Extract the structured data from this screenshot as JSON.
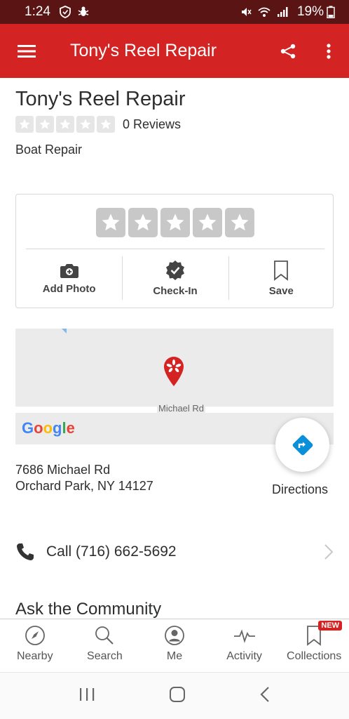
{
  "status_bar": {
    "time": "1:24",
    "battery": "19%"
  },
  "app_bar": {
    "title": "Tony's Reel Repair"
  },
  "business": {
    "name": "Tony's Reel Repair",
    "reviews": "0 Reviews",
    "rating": 0,
    "category": "Boat Repair"
  },
  "actions": [
    {
      "label": "Add Photo",
      "icon": "camera-icon"
    },
    {
      "label": "Check-In",
      "icon": "check-badge-icon"
    },
    {
      "label": "Save",
      "icon": "bookmark-icon"
    }
  ],
  "map": {
    "road_label": "Michael Rd",
    "provider": "Google"
  },
  "address": {
    "line1": "7686 Michael Rd",
    "line2": "Orchard Park, NY 14127"
  },
  "directions": {
    "label": "Directions"
  },
  "call": {
    "label": "Call (716) 662-5692"
  },
  "ask_community": {
    "title": "Ask the Community"
  },
  "bottom_nav": [
    {
      "label": "Nearby",
      "icon": "compass-icon"
    },
    {
      "label": "Search",
      "icon": "search-icon"
    },
    {
      "label": "Me",
      "icon": "profile-icon"
    },
    {
      "label": "Activity",
      "icon": "activity-icon"
    },
    {
      "label": "Collections",
      "icon": "bookmark-icon",
      "badge": "NEW"
    }
  ],
  "colors": {
    "brand_red": "#d32323",
    "status_bar": "#5b1414",
    "directions_blue": "#0b8fd8"
  }
}
